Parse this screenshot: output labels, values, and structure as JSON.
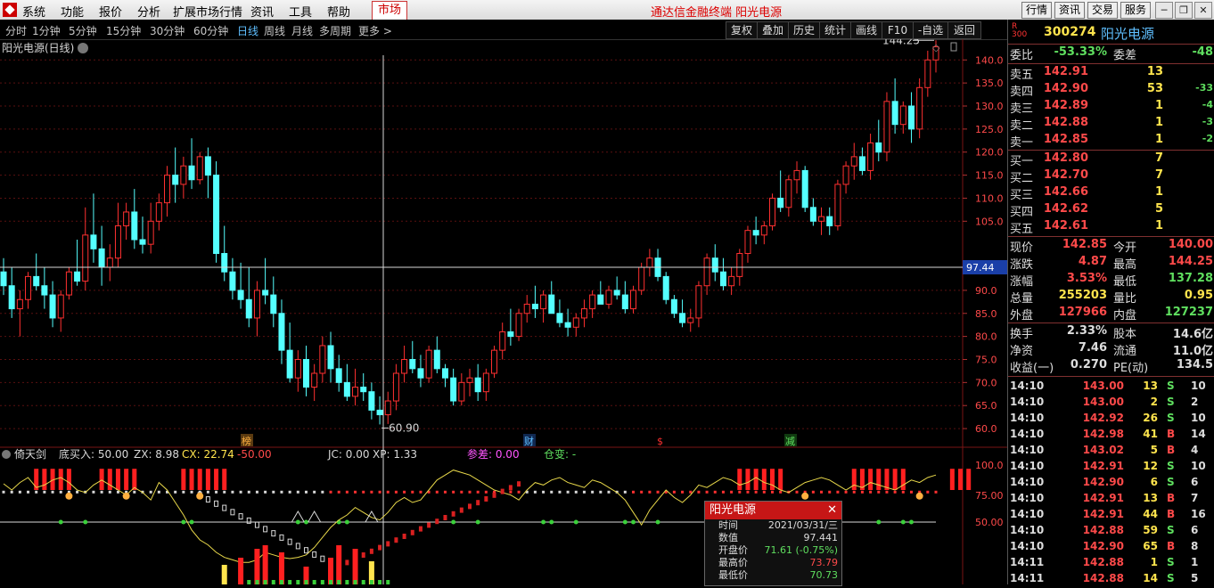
{
  "menubar": {
    "items": [
      "系统",
      "功能",
      "报价",
      "分析",
      "扩展市场行情",
      "资讯",
      "工具",
      "帮助"
    ],
    "market": "市场",
    "title": "通达信金融终端 阳光电源",
    "right": [
      "行情",
      "资讯",
      "交易",
      "服务"
    ]
  },
  "timeframes": {
    "items": [
      "分时",
      "1分钟",
      "5分钟",
      "15分钟",
      "30分钟",
      "60分钟",
      "日线",
      "周线",
      "月线",
      "多周期",
      "更多 >"
    ],
    "active": "日线"
  },
  "tools": [
    "复权",
    "叠加",
    "历史",
    "统计",
    "画线",
    "F10",
    "-自选",
    "返回"
  ],
  "chart": {
    "title": "阳光电源(日线)",
    "high_label": "144.25",
    "low_label": "60.90",
    "crosshair_value": "97.44",
    "price_axis": {
      "ticks": [
        140,
        135,
        130,
        125,
        120,
        115,
        110,
        105,
        95,
        90,
        85,
        80,
        75,
        70,
        65,
        60
      ],
      "min": 57.5,
      "max": 144.5
    },
    "markers": [
      "榜",
      "财",
      "$",
      "减"
    ],
    "candles": [
      [
        94,
        97,
        89,
        91
      ],
      [
        91,
        95,
        84,
        86
      ],
      [
        86,
        90,
        80,
        88
      ],
      [
        88,
        94,
        86,
        93
      ],
      [
        93,
        98,
        90,
        91
      ],
      [
        91,
        95,
        86,
        89
      ],
      [
        89,
        92,
        82,
        84
      ],
      [
        84,
        90,
        81,
        89
      ],
      [
        89,
        95,
        88,
        94
      ],
      [
        94,
        101,
        91,
        92
      ],
      [
        92,
        108,
        90,
        102
      ],
      [
        102,
        111,
        96,
        99
      ],
      [
        99,
        104,
        91,
        95
      ],
      [
        95,
        100,
        92,
        97
      ],
      [
        97,
        109,
        95,
        104
      ],
      [
        104,
        109,
        101,
        107
      ],
      [
        107,
        112,
        99,
        101
      ],
      [
        101,
        106,
        98,
        100
      ],
      [
        100,
        109,
        98,
        105
      ],
      [
        105,
        111,
        103,
        109
      ],
      [
        109,
        117,
        106,
        115
      ],
      [
        115,
        121,
        109,
        113
      ],
      [
        113,
        119,
        110,
        117
      ],
      [
        117,
        123,
        112,
        114
      ],
      [
        114,
        120,
        113,
        119
      ],
      [
        119,
        121,
        110,
        115
      ],
      [
        115,
        118,
        96,
        98
      ],
      [
        98,
        104,
        92,
        94
      ],
      [
        94,
        97,
        88,
        90
      ],
      [
        90,
        96,
        86,
        88
      ],
      [
        88,
        95,
        82,
        84
      ],
      [
        84,
        92,
        80,
        90
      ],
      [
        90,
        97,
        87,
        89
      ],
      [
        89,
        93,
        82,
        85
      ],
      [
        85,
        88,
        74,
        77
      ],
      [
        77,
        83,
        70,
        71
      ],
      [
        71,
        77,
        68,
        75
      ],
      [
        75,
        78,
        67,
        69
      ],
      [
        69,
        74,
        66,
        72
      ],
      [
        72,
        80,
        70,
        78
      ],
      [
        78,
        81,
        70,
        73
      ],
      [
        73,
        76,
        68,
        70
      ],
      [
        70,
        74,
        66,
        67
      ],
      [
        67,
        73,
        65,
        69
      ],
      [
        69,
        72,
        66,
        68
      ],
      [
        68,
        70,
        62,
        64
      ],
      [
        64,
        67,
        60.9,
        63
      ],
      [
        63,
        68,
        61,
        66
      ],
      [
        66,
        74,
        64,
        72
      ],
      [
        72,
        78,
        70,
        75
      ],
      [
        75,
        79,
        72,
        73
      ],
      [
        73,
        76,
        69,
        71
      ],
      [
        71,
        78,
        70,
        77
      ],
      [
        77,
        80,
        72,
        73
      ],
      [
        73,
        74,
        69,
        71
      ],
      [
        71,
        73,
        65,
        66
      ],
      [
        66,
        72,
        65,
        70
      ],
      [
        70,
        73,
        67,
        71
      ],
      [
        71,
        74,
        66,
        68
      ],
      [
        68,
        73,
        66,
        72
      ],
      [
        72,
        78,
        71,
        77
      ],
      [
        77,
        83,
        75,
        81
      ],
      [
        81,
        86,
        78,
        80
      ],
      [
        80,
        86,
        79,
        85
      ],
      [
        85,
        89,
        83,
        87
      ],
      [
        87,
        91,
        84,
        86
      ],
      [
        86,
        90,
        83,
        89
      ],
      [
        89,
        92,
        85,
        85
      ],
      [
        85,
        88,
        82,
        83
      ],
      [
        83,
        86,
        80,
        82
      ],
      [
        82,
        85,
        80,
        84
      ],
      [
        84,
        88,
        82,
        86
      ],
      [
        86,
        90,
        84,
        89
      ],
      [
        89,
        92,
        87,
        87
      ],
      [
        87,
        91,
        86,
        90
      ],
      [
        90,
        93,
        88,
        89
      ],
      [
        89,
        92,
        85,
        86
      ],
      [
        86,
        91,
        85,
        90
      ],
      [
        90,
        96,
        89,
        95
      ],
      [
        95,
        99,
        93,
        97
      ],
      [
        97,
        99,
        92,
        93
      ],
      [
        93,
        94,
        87,
        88
      ],
      [
        88,
        89,
        84,
        85
      ],
      [
        85,
        88,
        82,
        83
      ],
      [
        83,
        86,
        81,
        84
      ],
      [
        84,
        92,
        82,
        91
      ],
      [
        91,
        98,
        89,
        97
      ],
      [
        97,
        100,
        92,
        94
      ],
      [
        94,
        97,
        90,
        91
      ],
      [
        91,
        95,
        89,
        93
      ],
      [
        93,
        99,
        91,
        98
      ],
      [
        98,
        104,
        96,
        103
      ],
      [
        103,
        106,
        100,
        102
      ],
      [
        102,
        105,
        100,
        104
      ],
      [
        104,
        111,
        103,
        110
      ],
      [
        110,
        116,
        107,
        108
      ],
      [
        108,
        115,
        106,
        114
      ],
      [
        114,
        118,
        111,
        116
      ],
      [
        116,
        117,
        107,
        108
      ],
      [
        108,
        110,
        104,
        105
      ],
      [
        105,
        108,
        102,
        106
      ],
      [
        106,
        108,
        102,
        104
      ],
      [
        104,
        114,
        103,
        113
      ],
      [
        113,
        118,
        111,
        117
      ],
      [
        117,
        122,
        114,
        119
      ],
      [
        119,
        121,
        115,
        116
      ],
      [
        116,
        124,
        114,
        122
      ],
      [
        122,
        127,
        118,
        120
      ],
      [
        120,
        133,
        118,
        131
      ],
      [
        131,
        136,
        124,
        126
      ],
      [
        126,
        131,
        124,
        130
      ],
      [
        130,
        133,
        122,
        125
      ],
      [
        125,
        136,
        123,
        134
      ],
      [
        134,
        142,
        132,
        140
      ],
      [
        140,
        144.25,
        137.28,
        142.85
      ]
    ]
  },
  "indicator": {
    "name": "倚天剑",
    "readouts": [
      {
        "label": "底买入: 50.00",
        "color": "#d8d8d8"
      },
      {
        "label": "ZX: 8.98",
        "color": "#d8d8d8"
      },
      {
        "label": "CX: 22.74",
        "color": "#ffe44d"
      },
      {
        "label": "-50.00",
        "color": "#ff4a4a"
      },
      {
        "label": "JC: 0.00",
        "color": "#d8d8d8"
      },
      {
        "label": "XP: 1.33",
        "color": "#d8d8d8"
      },
      {
        "label": "参差: 0.00",
        "color": "#ff55ff"
      },
      {
        "label": "仓变: -",
        "color": "#5fdf5f"
      }
    ],
    "axis": [
      "100.0",
      "75.00",
      "50.00"
    ]
  },
  "popup": {
    "title": "阳光电源",
    "rows": [
      {
        "k": "时间",
        "v": "2021/03/31/三",
        "c": "#ddd"
      },
      {
        "k": "数值",
        "v": "97.441",
        "c": "#ddd"
      },
      {
        "k": "开盘价",
        "v": "71.61 (-0.75%)",
        "c": "#5fdf5f"
      },
      {
        "k": "最高价",
        "v": "73.79",
        "c": "#ff4a4a"
      },
      {
        "k": "最低价",
        "v": "70.73",
        "c": "#5fdf5f"
      }
    ]
  },
  "quote": {
    "badge_r": "R",
    "badge_num": "300",
    "code": "300274",
    "name": "阳光电源",
    "weibi": {
      "l1": "委比",
      "v1": "-53.33%",
      "l2": "委差",
      "v2": "-48"
    },
    "asks": [
      {
        "l": "卖五",
        "p": "142.91",
        "v": "13",
        "d": ""
      },
      {
        "l": "卖四",
        "p": "142.90",
        "v": "53",
        "d": "-33"
      },
      {
        "l": "卖三",
        "p": "142.89",
        "v": "1",
        "d": "-4"
      },
      {
        "l": "卖二",
        "p": "142.88",
        "v": "1",
        "d": "-3"
      },
      {
        "l": "卖一",
        "p": "142.85",
        "v": "1",
        "d": "-2"
      }
    ],
    "bids": [
      {
        "l": "买一",
        "p": "142.80",
        "v": "7",
        "d": ""
      },
      {
        "l": "买二",
        "p": "142.70",
        "v": "7",
        "d": ""
      },
      {
        "l": "买三",
        "p": "142.66",
        "v": "1",
        "d": ""
      },
      {
        "l": "买四",
        "p": "142.62",
        "v": "5",
        "d": ""
      },
      {
        "l": "买五",
        "p": "142.61",
        "v": "1",
        "d": ""
      }
    ],
    "stats": [
      {
        "l1": "现价",
        "v1": "142.85",
        "c1": "#ff4a4a",
        "l2": "今开",
        "v2": "140.00",
        "c2": "#ff4a4a"
      },
      {
        "l1": "涨跌",
        "v1": "4.87",
        "c1": "#ff4a4a",
        "l2": "最高",
        "v2": "144.25",
        "c2": "#ff4a4a"
      },
      {
        "l1": "涨幅",
        "v1": "3.53%",
        "c1": "#ff4a4a",
        "l2": "最低",
        "v2": "137.28",
        "c2": "#5fdf5f"
      },
      {
        "l1": "总量",
        "v1": "255203",
        "c1": "#ffe44d",
        "l2": "量比",
        "v2": "0.95",
        "c2": "#ffe44d"
      },
      {
        "l1": "外盘",
        "v1": "127966",
        "c1": "#ff4a4a",
        "l2": "内盘",
        "v2": "127237",
        "c2": "#5fdf5f"
      }
    ],
    "stats2": [
      {
        "l1": "换手",
        "v1": "2.33%",
        "l2": "股本",
        "v2": "14.6亿"
      },
      {
        "l1": "净资",
        "v1": "7.46",
        "l2": "流通",
        "v2": "11.0亿"
      },
      {
        "l1": "收益(一)",
        "v1": "0.270",
        "l2": "PE(动)",
        "v2": "134.5"
      }
    ],
    "ticks": [
      {
        "t": "14:10",
        "p": "143.00",
        "v": "13",
        "bs": "S",
        "n": "10"
      },
      {
        "t": "14:10",
        "p": "143.00",
        "v": "2",
        "bs": "S",
        "n": "2"
      },
      {
        "t": "14:10",
        "p": "142.92",
        "v": "26",
        "bs": "S",
        "n": "10"
      },
      {
        "t": "14:10",
        "p": "142.98",
        "v": "41",
        "bs": "B",
        "n": "14"
      },
      {
        "t": "14:10",
        "p": "143.02",
        "v": "5",
        "bs": "B",
        "n": "4"
      },
      {
        "t": "14:10",
        "p": "142.91",
        "v": "12",
        "bs": "S",
        "n": "10"
      },
      {
        "t": "14:10",
        "p": "142.90",
        "v": "6",
        "bs": "S",
        "n": "6"
      },
      {
        "t": "14:10",
        "p": "142.91",
        "v": "13",
        "bs": "B",
        "n": "7"
      },
      {
        "t": "14:10",
        "p": "142.91",
        "v": "44",
        "bs": "B",
        "n": "16"
      },
      {
        "t": "14:10",
        "p": "142.88",
        "v": "59",
        "bs": "S",
        "n": "6"
      },
      {
        "t": "14:10",
        "p": "142.90",
        "v": "65",
        "bs": "B",
        "n": "8"
      },
      {
        "t": "14:11",
        "p": "142.88",
        "v": "1",
        "bs": "S",
        "n": "1"
      },
      {
        "t": "14:11",
        "p": "142.88",
        "v": "14",
        "bs": "S",
        "n": "5"
      }
    ]
  },
  "colors": {
    "up": "#ff3030",
    "down": "#54ffff",
    "grid": "#5a1010",
    "green": "#5fdf5f",
    "yellow": "#ffe44d"
  }
}
